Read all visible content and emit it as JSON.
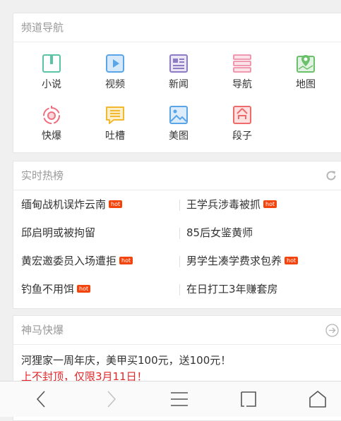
{
  "nav_card": {
    "title": "频道导航",
    "items": [
      {
        "label": "小说",
        "icon": "book-icon",
        "color": "#5bc4a6"
      },
      {
        "label": "视频",
        "icon": "video-play-icon",
        "color": "#5aa4e8"
      },
      {
        "label": "新闻",
        "icon": "newspaper-icon",
        "color": "#8d7cc3"
      },
      {
        "label": "导航",
        "icon": "menu-list-icon",
        "color": "#ee8ea8"
      },
      {
        "label": "地图",
        "icon": "map-pin-icon",
        "color": "#6bc16b"
      },
      {
        "label": "快爆",
        "icon": "burst-icon",
        "color": "#f07080"
      },
      {
        "label": "吐槽",
        "icon": "chat-lines-icon",
        "color": "#f2b930"
      },
      {
        "label": "美图",
        "icon": "picture-icon",
        "color": "#5aa4e8"
      },
      {
        "label": "段子",
        "icon": "joke-face-icon",
        "color": "#ef6a6a"
      }
    ]
  },
  "hot_card": {
    "title": "实时热榜",
    "badge_text": "hot",
    "rows": [
      {
        "left": "缅甸战机误炸云南",
        "left_hot": true,
        "right": "王学兵涉毒被抓",
        "right_hot": true
      },
      {
        "left": "邱启明或被拘留",
        "left_hot": false,
        "right": "85后女鉴黄师",
        "right_hot": false
      },
      {
        "left": "黄宏邀委员入场遭拒",
        "left_hot": true,
        "right": "男学生凑学费求包养",
        "right_hot": true
      },
      {
        "left": "钓鱼不用饵",
        "left_hot": true,
        "right": "在日打工3年赚套房",
        "right_hot": false
      }
    ]
  },
  "sm_card": {
    "title": "神马快爆",
    "line1": "河狸家一周年庆，美甲买100元，送100元！",
    "line2": "上不封顶，仅限3月11日！"
  },
  "colors": {
    "badge": "#f3440d",
    "promo_red": "#e3262a"
  }
}
